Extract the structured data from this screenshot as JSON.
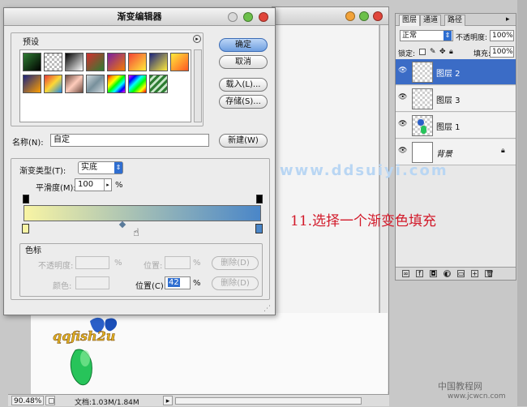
{
  "dialog": {
    "title": "渐变编辑器",
    "presets_label": "预设",
    "ok": "确定",
    "cancel": "取消",
    "load": "载入(L)...",
    "save": "存储(S)...",
    "name_label": "名称(N):",
    "name_value": "自定",
    "new_button": "新建(W)",
    "gradient_type_label": "渐变类型(T):",
    "gradient_type_value": "实底",
    "smoothness_label": "平滑度(M):",
    "smoothness_value": "100",
    "smoothness_unit": "%",
    "stops_label": "色标",
    "opacity_label": "不透明度:",
    "opacity_unit": "%",
    "location_label": "位置:",
    "location_unit": "%",
    "delete_button": "删除(D)",
    "color_label": "颜色:",
    "location2_label": "位置(C):",
    "location2_value": "42",
    "location2_unit": "%",
    "gradient_colors": [
      "#f8f4a4",
      "#4a86c8"
    ]
  },
  "presets": [
    [
      "#2e7d32,#000",
      "checker-fg",
      "#000,#fff",
      "#d32f2f,#2e7d32",
      "#7a1fa2,#f57c00",
      "#f44336,#ffeb3b",
      "#1a237e,#ffeb3b",
      "#ffeb3b,#ff5722"
    ],
    [
      "#1a237e,#ffa000",
      "#e53935,#fdd835,#1e88e5",
      "#6d4c41,#ffccbc,#6d4c41",
      "#cfd8dc,#78909c,#cfd8dc",
      "rainbow",
      "rainbow2",
      "stripes",
      ""
    ]
  ],
  "layers": {
    "tabs": [
      "图层",
      "通道",
      "路径"
    ],
    "blend_mode": "正常",
    "opacity_label": "不透明度:",
    "opacity_value": "100%",
    "lock_label": "锁定:",
    "fill_label": "填充:",
    "fill_value": "100%",
    "items": [
      {
        "name": "图层 2",
        "selected": true
      },
      {
        "name": "图层 3",
        "selected": false
      },
      {
        "name": "图层 1",
        "selected": false
      },
      {
        "name": "背景",
        "selected": false
      }
    ]
  },
  "status": {
    "zoom": "90.48%",
    "doc": "文档:1.03M/1.84M"
  },
  "overlay": {
    "watermark": "www.ddsuiyi.com",
    "instruction": "11.选择一个渐变色填充",
    "site_name": "中国教程网",
    "site_url": "www.jcwcn.com"
  },
  "logo_text": "qqfish2u"
}
